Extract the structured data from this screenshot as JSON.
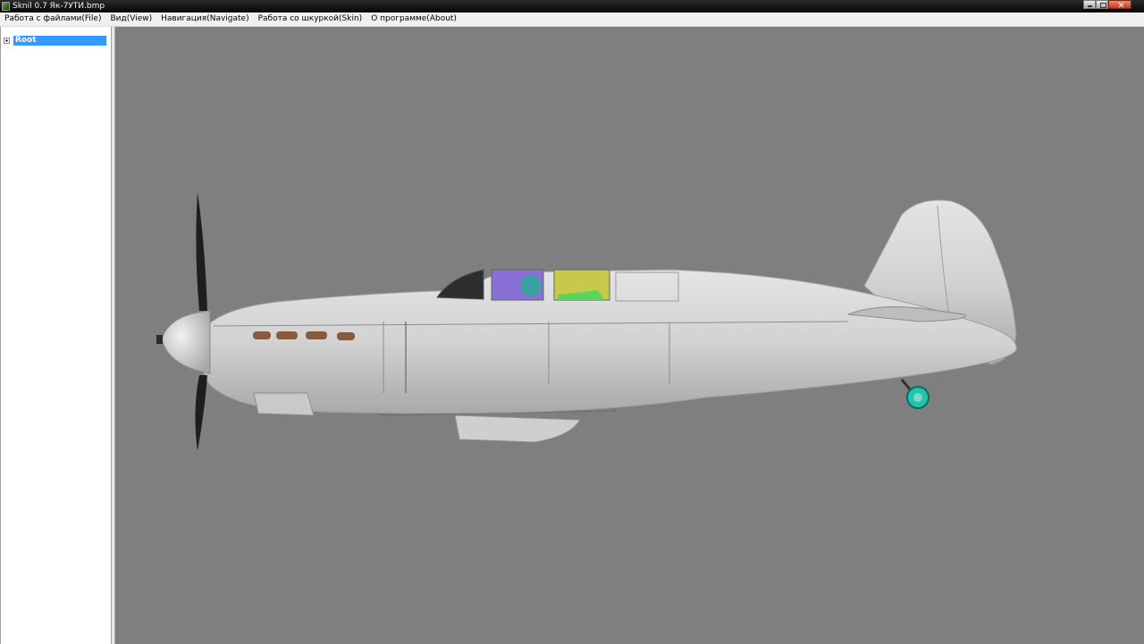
{
  "window": {
    "title": "Sknil 0.7   Як-7УТИ.bmp"
  },
  "menu": {
    "items": [
      "Работа с файлами(File)",
      "Вид(View)",
      "Навигация(Navigate)",
      "Работа со шкуркой(Skin)",
      "О программе(About)"
    ]
  },
  "tree": {
    "root_label": "Root"
  },
  "viewport": {
    "background": "#7f7f7f",
    "model_description_icon": "aircraft-3d-model"
  },
  "colors": {
    "selection": "#3399ff",
    "fuselage": "#d8d8d8",
    "canopy_purple": "#8a6fd6",
    "canopy_yellow": "#c8c84a",
    "tailwheel": "#22c4b0"
  }
}
